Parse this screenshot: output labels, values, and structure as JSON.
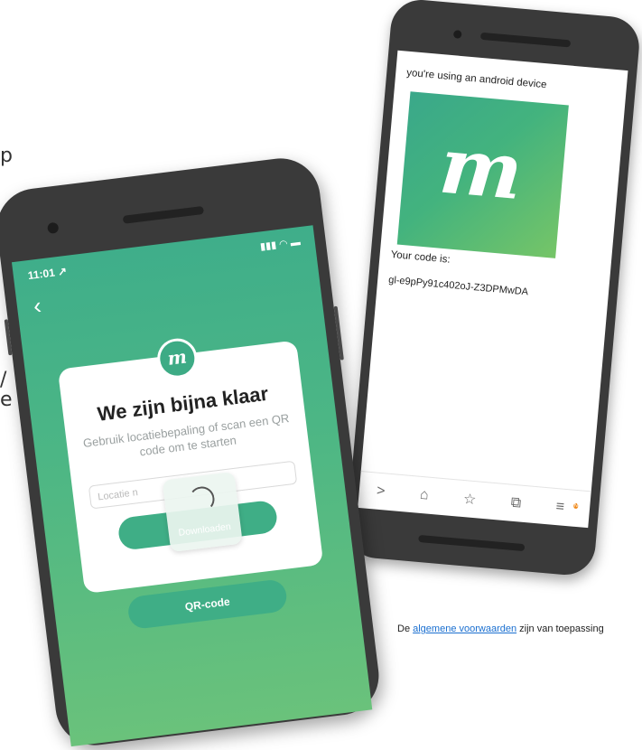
{
  "edge_fragments": [
    "p",
    "/",
    "e"
  ],
  "android_phone": {
    "message": "you're using an android device",
    "logo_glyph": "m",
    "code_label": "Your code is:",
    "code_value": "gl-e9pPy91c402oJ-Z3DPMwDA",
    "nav_icons": [
      "chevron-right-icon",
      "home-icon",
      "star-icon",
      "tabs-icon",
      "menu-icon"
    ],
    "nav_glyphs": [
      ">",
      "⌂",
      "☆",
      "⧉",
      "≡"
    ],
    "menu_badge": "N"
  },
  "iphone": {
    "status_time": "11:01 ↗",
    "status_icons": "▮▮▮ ◠ ▬",
    "back_glyph": "‹",
    "card_logo": "m",
    "title": "We zijn bijna klaar",
    "subtitle": "Gebruik locatiebepaling of scan een QR code om te starten",
    "location_placeholder": "Locatie n",
    "loading_label": "Downloaden",
    "qr_button": "QR-code"
  },
  "footer": {
    "prefix": "De ",
    "link": "algemene voorwaarden",
    "suffix": " zijn van toepassing"
  },
  "colors": {
    "brand_green": "#3fae86",
    "badge_orange": "#f08a1c",
    "link_blue": "#1a6fd0"
  }
}
